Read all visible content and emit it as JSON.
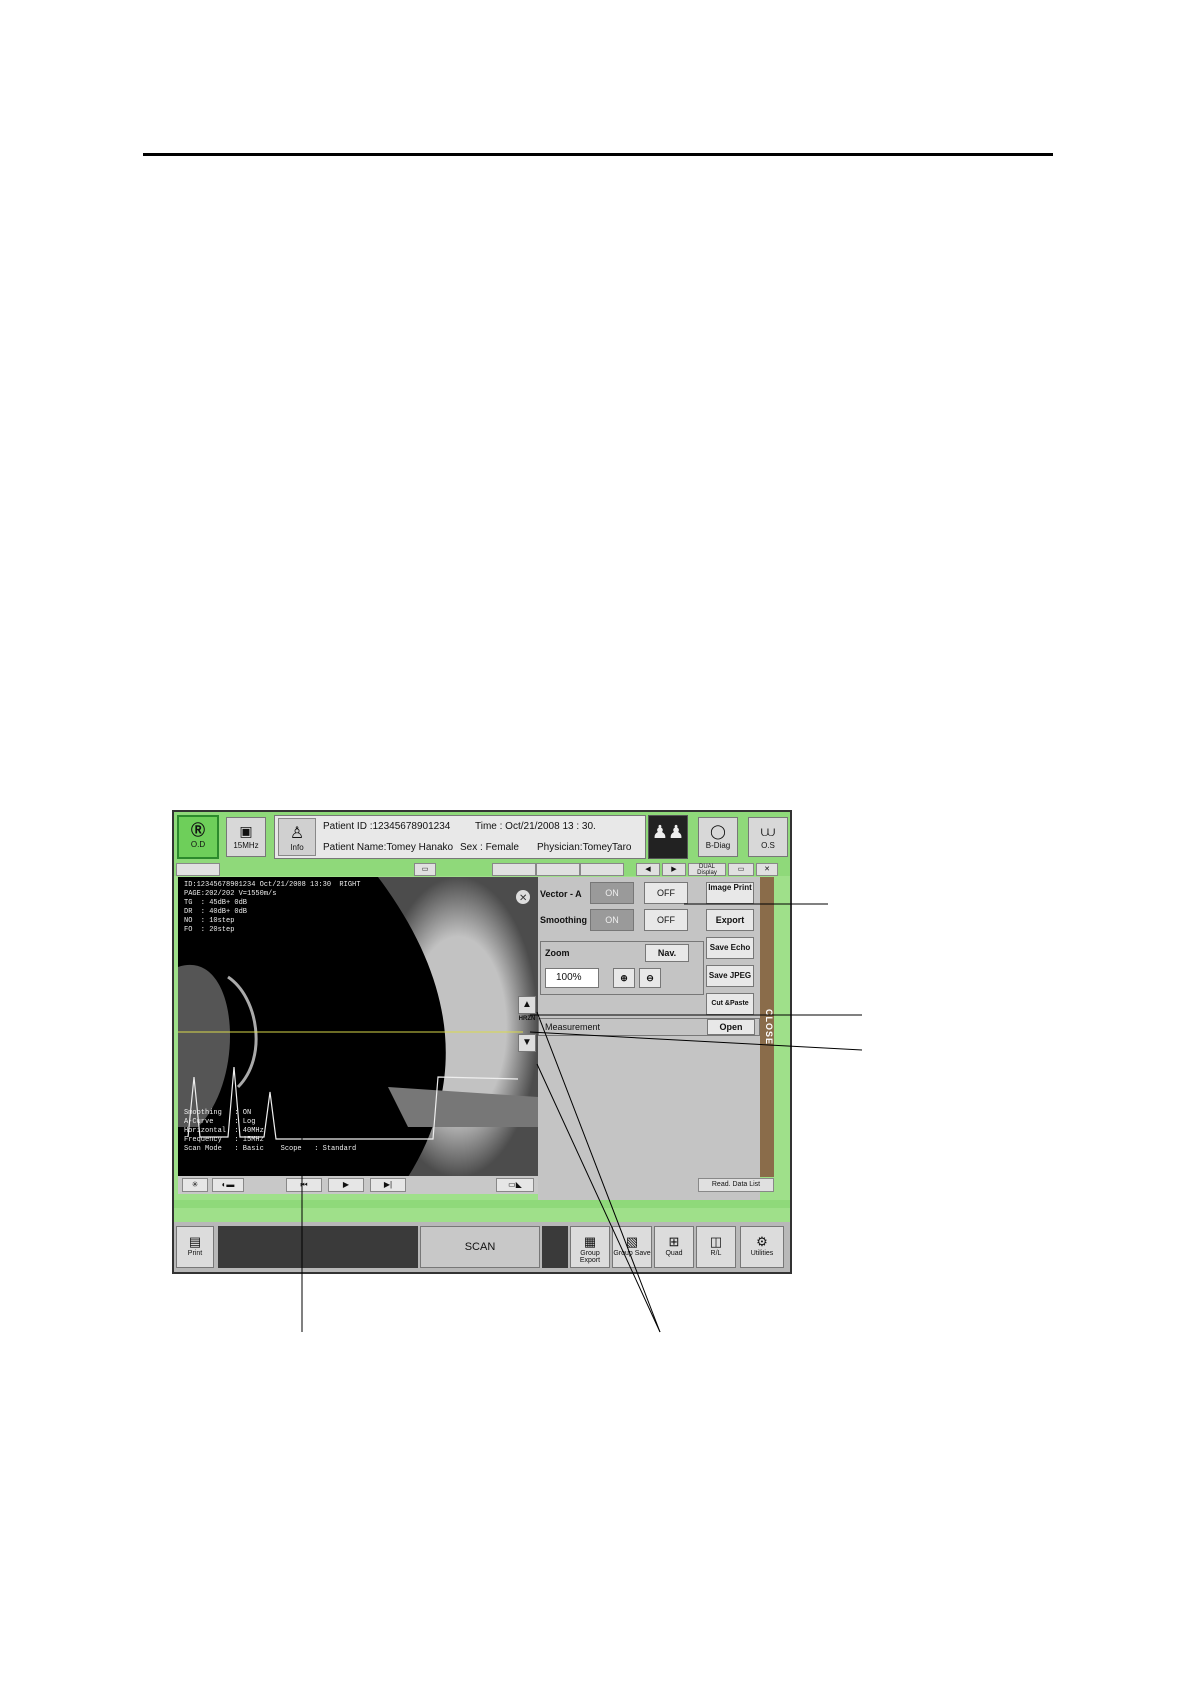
{
  "header": {
    "od_label": "O.D",
    "freq_label": "15MHz",
    "info_label": "Info",
    "patient_id": "Patient ID    :12345678901234",
    "time": "Time : Oct/21/2008   13 : 30.",
    "patient_name": "Patient Name:Tomey Hanako",
    "sex": "Sex : Female",
    "physician": "Physician:TomeyTaro",
    "bdiag_label": "B-Diag",
    "os_label": "O.S"
  },
  "tabs": {
    "dual_display": "DUAL Display"
  },
  "viewer": {
    "info_lines": "ID:12345678901234 Oct/21/2008 13:30  RIGHT\nPAGE:202/202 V=1550m/s\nTG  : 45dB+ 0dB\nDR  : 40dB+ 0dB\nNO  : 10step\nFO  : 20step",
    "settings_lines": "Smoothing   : ON\nA-Curve     : Log\nHorizontal  : 40MHz\nFrequency   : 15MHz\nScan Mode   : Basic    Scope   : Standard",
    "right_badge": "RIGHT"
  },
  "panel": {
    "vector_label": "Vector - A",
    "on": "ON",
    "off": "OFF",
    "smoothing_label": "Smoothing",
    "zoom_label": "Zoom",
    "nav_label": "Nav.",
    "zoom_value": "100%",
    "image_print": "Image Print",
    "export": "Export",
    "save_echo": "Save Echo",
    "save_jpeg": "Save JPEG",
    "cut_paste": "Cut &Paste",
    "measurement_label": "Measurement",
    "open": "Open",
    "close": "CLOSE",
    "hrzn": "HRZN",
    "read_data_list": "Read. Data List"
  },
  "footer": {
    "print": "Print",
    "scan": "SCAN",
    "group_export": "Group Export",
    "group_save": "Group Save",
    "quad": "Quad",
    "rl": "R/L",
    "utilities": "Utilities"
  }
}
